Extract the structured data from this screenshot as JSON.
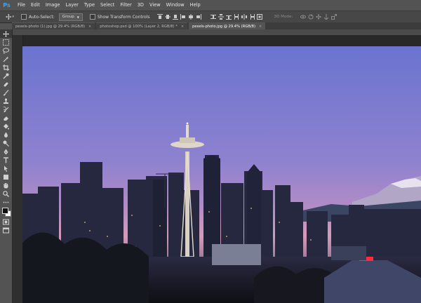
{
  "menubar": {
    "logo": "Ps",
    "items": [
      "File",
      "Edit",
      "Image",
      "Layer",
      "Type",
      "Select",
      "Filter",
      "3D",
      "View",
      "Window",
      "Help"
    ]
  },
  "options": {
    "auto_select_label": "Auto-Select:",
    "group_value": "Group",
    "transform_label": "Show Transform Controls",
    "mode_3d_label": "3D Mode:"
  },
  "tabs": [
    {
      "label": "pexels-photo (1).jpg @ 29.4% (RGB/8)",
      "close": "×",
      "active": false
    },
    {
      "label": "photoshop.psd @ 100% (Layer 2, RGB/8) *",
      "close": "×",
      "active": false
    },
    {
      "label": "pexels-photo.jpg @ 29.4% (RGB/8)",
      "close": "×",
      "active": true
    }
  ],
  "colors": {
    "sky_top": "#6a74cf",
    "sky_mid": "#8e82cf",
    "sky_horizon": "#d49bb9",
    "foreground": "#111111",
    "background": "#ffffff",
    "accent_red": "#ff2a3a"
  }
}
